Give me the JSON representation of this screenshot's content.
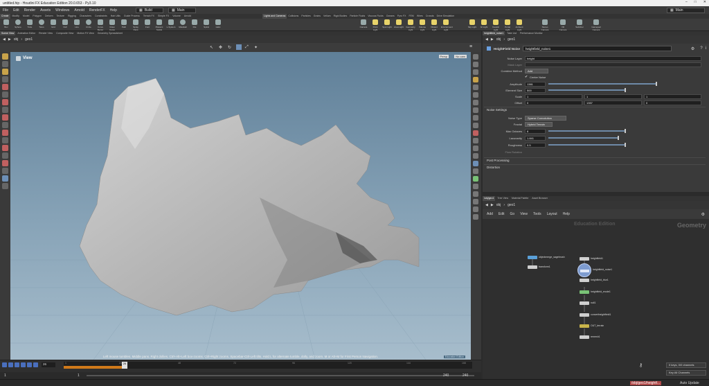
{
  "window": {
    "title": "untitled.hip - Houdini FX Education Edition 20.0.653 - Py3.10",
    "controls": [
      "–",
      "□",
      "✕"
    ]
  },
  "menu": {
    "items": [
      "File",
      "Edit",
      "Render",
      "Assets",
      "Windows",
      "Arnold",
      "RenderFX",
      "Help"
    ],
    "desktop": "Build",
    "main": "Main",
    "right_desktop": "Main"
  },
  "shelf": {
    "tabs": [
      "Create",
      "Modify",
      "Model",
      "Polygon",
      "Deform",
      "Texture",
      "Rigging",
      "Characters",
      "Constraints",
      "Hair Utils",
      "Guide Process",
      "Terrain FX",
      "Simple FX",
      "Volume",
      "Arnold"
    ],
    "right_tabs": [
      "Lights and Cameras",
      "Collisions",
      "Particles",
      "Grains",
      "Vellum",
      "Rigid Bodies",
      "Particle Fluids",
      "Viscous Fluids",
      "Oceans",
      "Pyro FX",
      "FEM",
      "Wires",
      "Crowds",
      "Drive Simulation"
    ],
    "tools": [
      "Box",
      "Sphere",
      "Tube",
      "Torus",
      "Grid",
      "Null",
      "Line",
      "Circle",
      "Curve Bezier",
      "Draw Curve",
      "Path",
      "Spray Paint",
      "Font",
      "Platonic Solids",
      "L-System",
      "Metaball",
      "File",
      "Spiral",
      "Helix"
    ],
    "right_tools": [
      "Camera",
      "Point Light",
      "Spot Light",
      "Area Light",
      "Geometry Light",
      "Volume Light",
      "Distant Light",
      "Environment Light",
      "Sky Light",
      "GI Light",
      "Caustic Light",
      "Portal Light",
      "Ambient Light",
      "Stereo Camera",
      "VR Camera",
      "Switcher",
      "Gamepad Camera"
    ]
  },
  "left_pane": {
    "tabs": [
      "Scene View",
      "Animation Editor",
      "Render View",
      "Composite View",
      "Motion FX View",
      "Geometry Spreadsheet"
    ],
    "path": [
      "obj",
      "geo1"
    ],
    "viewport_label": "View",
    "camera_menu": "Persp",
    "no_cam": "No cam",
    "hint": "Left mouse tumbles. Middle pans. Right dollies. Ctrl+Alt+Left box-zooms. Ctrl+Right zooms. Spacebar-Ctrl-Left tilts. Hold L for alternate tumble, dolly, and zoom. M or Alt+M for First Person Navigation.",
    "edu_badge": "Education Edition"
  },
  "timeline": {
    "frame": "26",
    "ticks": [
      "1",
      "24",
      "48",
      "72",
      "96",
      "120",
      "144",
      "168",
      "192",
      "216",
      "240"
    ],
    "current": "26",
    "range_start": "1",
    "range_sub": "1",
    "range_end": "240",
    "range_end2": "240"
  },
  "params": {
    "tabs": [
      "heightfield_noise1",
      "Take List",
      "Performance Monitor"
    ],
    "path": [
      "obj",
      "geo1"
    ],
    "node_type": "HeightField Noise",
    "node_name": "heightfield_noise1",
    "rows": [
      {
        "label": "Noise Layer",
        "value": "height"
      },
      {
        "label": "Mask Layer",
        "value": ""
      },
      {
        "label": "Combine Method",
        "value": "Add"
      },
      {
        "label": "",
        "value": "Center Noise"
      },
      {
        "label": "Amplitude",
        "value": "1381"
      },
      {
        "label": "Element Size",
        "value": "500"
      },
      {
        "label": "Scale",
        "value": "1",
        "v2": "1",
        "v3": "1"
      },
      {
        "label": "Offset",
        "value": "0",
        "v2": "1357",
        "v3": "0"
      }
    ],
    "section_noise": "Noise Settings",
    "noise_rows": [
      {
        "label": "Noise Type",
        "value": "Sparse Convolution"
      },
      {
        "label": "Fractal",
        "value": "Hybrid Terrain"
      },
      {
        "label": "Max Octaves",
        "value": "8"
      },
      {
        "label": "Lacunarity",
        "value": "1.841"
      },
      {
        "label": "Roughness",
        "value": "0.5"
      },
      {
        "label": "Flow Rotation",
        "value": ""
      }
    ],
    "section_post": "Post Processing",
    "section_distortion": "Distortion"
  },
  "network": {
    "tabs": [
      "/obj/geo1",
      "Tree View",
      "Material Palette",
      "Asset Browser"
    ],
    "path": [
      "obj",
      "geo1"
    ],
    "menu": [
      "Add",
      "Edit",
      "Go",
      "View",
      "Tools",
      "Layout",
      "Help"
    ],
    "watermark": "Education Edition",
    "context": "Geometry",
    "nodes": [
      {
        "name": "objectmerge_sagebrush",
        "color": "#5aa0d8"
      },
      {
        "name": "transform1",
        "color": "#cfcfcf"
      },
      {
        "name": "heightfield1",
        "color": "#cfcfcf"
      },
      {
        "name": "heightfield_noise1",
        "color": "#6aa0e0"
      },
      {
        "name": "heightfield_blur1",
        "color": "#cfcfcf"
      },
      {
        "name": "heightfield_erode1",
        "color": "#79c276"
      },
      {
        "name": "null1",
        "color": "#cfcfcf"
      },
      {
        "name": "convertheightfield1",
        "color": "#cfcfcf"
      },
      {
        "name": "OUT_terrain",
        "color": "#c9b44a"
      },
      {
        "name": "remesh1",
        "color": "#cfcfcf"
      }
    ]
  },
  "right_bottom": {
    "keys": "0 keys, 0/0 channels",
    "key_all": "Key All Channels",
    "path_status": "/obj/geo1/heightf...",
    "auto_update": "Auto Update"
  }
}
